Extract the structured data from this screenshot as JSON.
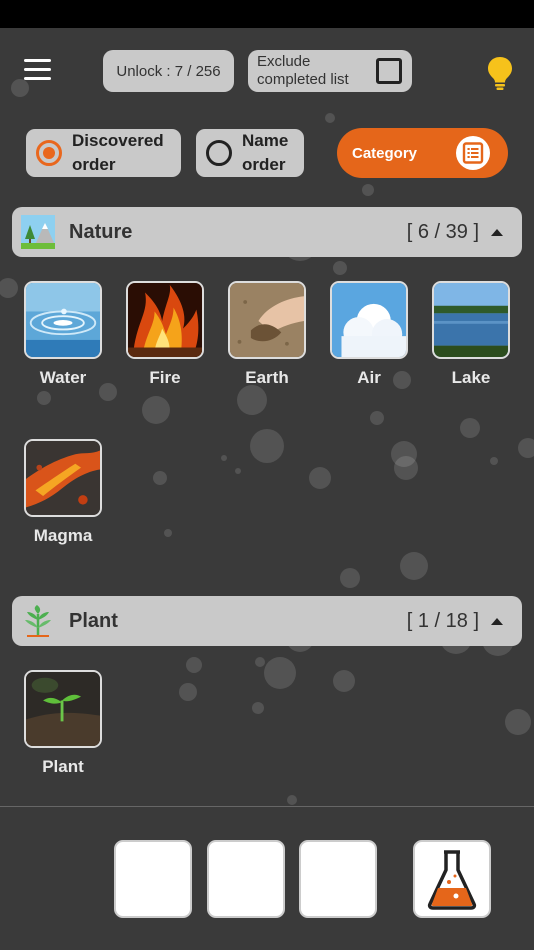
{
  "header": {
    "unlock_text": "Unlock : 7 / 256",
    "exclude_line1": "Exclude",
    "exclude_line2": "completed list",
    "exclude_checked": false
  },
  "sort": {
    "discovered_line1": "Discovered",
    "discovered_line2": "order",
    "name_line1": "Name",
    "name_line2": "order",
    "selected": "discovered",
    "category_label": "Category"
  },
  "sections": [
    {
      "title": "Nature",
      "count": "[ 6 / 39 ]",
      "icon": "nature-icon",
      "items": [
        {
          "label": "Water"
        },
        {
          "label": "Fire"
        },
        {
          "label": "Earth"
        },
        {
          "label": "Air"
        },
        {
          "label": "Lake"
        },
        {
          "label": "Magma"
        }
      ]
    },
    {
      "title": "Plant",
      "count": "[ 1 / 18 ]",
      "icon": "sprout-icon",
      "items": [
        {
          "label": "Plant"
        }
      ]
    }
  ],
  "colors": {
    "accent": "#e5661a",
    "background": "#3a3a3a",
    "pill": "#c9c9c9",
    "bulb": "#f6c21b"
  }
}
